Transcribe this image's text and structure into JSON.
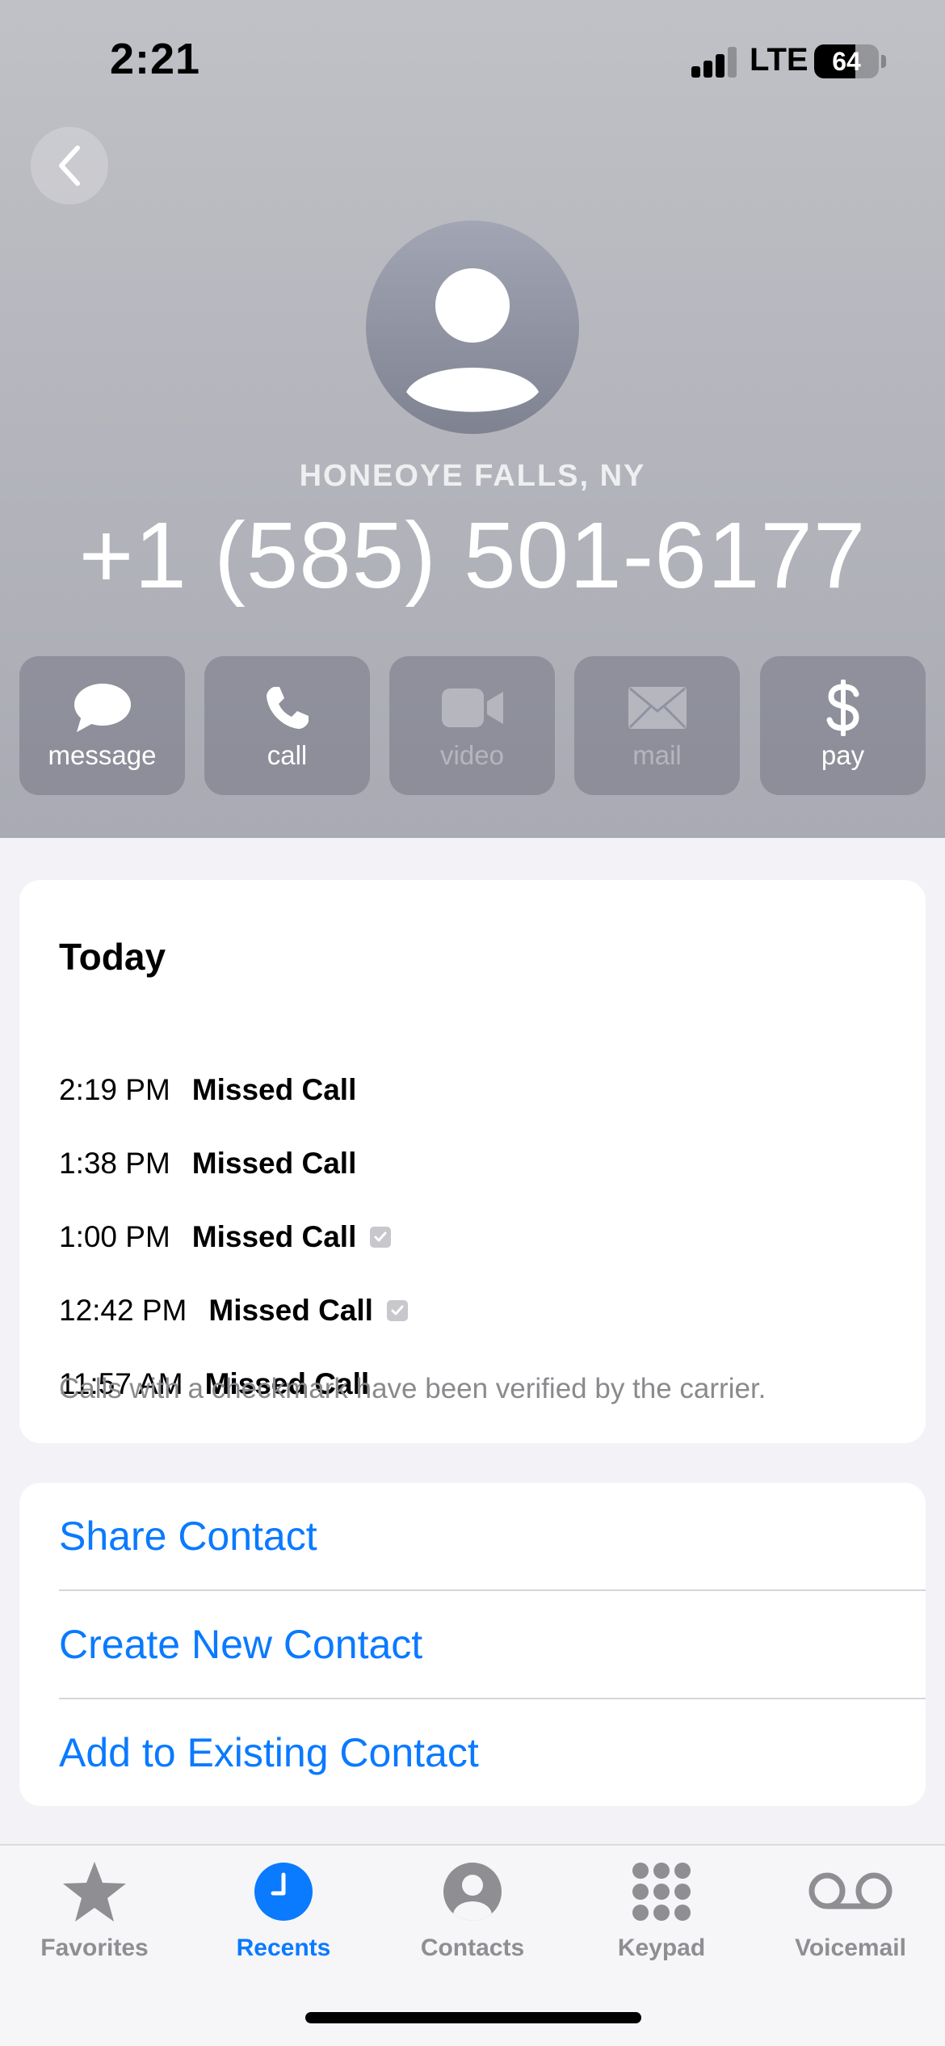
{
  "status_bar": {
    "time": "2:21",
    "network": "LTE",
    "battery_level": "64",
    "battery_fraction": 0.64,
    "signal_bars_active": 3,
    "signal_bars_total": 4
  },
  "contact": {
    "location": "HONEOYE FALLS, NY",
    "phone_number": "+1 (585) 501-6177",
    "avatar_icon": "person-placeholder-icon"
  },
  "actions": [
    {
      "label": "message",
      "icon": "message-bubble-icon",
      "enabled": true
    },
    {
      "label": "call",
      "icon": "phone-icon",
      "enabled": true
    },
    {
      "label": "video",
      "icon": "video-camera-icon",
      "enabled": false
    },
    {
      "label": "mail",
      "icon": "envelope-icon",
      "enabled": false
    },
    {
      "label": "pay",
      "icon": "dollar-icon",
      "enabled": true
    }
  ],
  "history": {
    "heading": "Today",
    "calls": [
      {
        "time": "2:19 PM",
        "type": "Missed Call",
        "verified": false
      },
      {
        "time": "1:38 PM",
        "type": "Missed Call",
        "verified": false
      },
      {
        "time": "1:00 PM",
        "type": "Missed Call",
        "verified": true
      },
      {
        "time": "12:42 PM",
        "type": "Missed Call",
        "verified": true
      },
      {
        "time": "11:57 AM",
        "type": "Missed Call",
        "verified": false
      }
    ],
    "note": "Calls with a checkmark have been verified by the carrier."
  },
  "contact_actions": {
    "share": "Share Contact",
    "create": "Create New Contact",
    "add_existing": "Add to Existing Contact"
  },
  "tab_bar": {
    "tabs": [
      {
        "label": "Favorites",
        "icon": "star-icon",
        "active": false
      },
      {
        "label": "Recents",
        "icon": "clock-icon",
        "active": true
      },
      {
        "label": "Contacts",
        "icon": "person-circle-icon",
        "active": false
      },
      {
        "label": "Keypad",
        "icon": "keypad-icon",
        "active": false
      },
      {
        "label": "Voicemail",
        "icon": "voicemail-icon",
        "active": false
      }
    ]
  },
  "colors": {
    "accent": "#0a7aff",
    "header_top": "#c0c1c6",
    "header_bottom": "#a9aab3",
    "inactive_tab": "#8e8e93",
    "verified_badge": "#c7c7cc"
  }
}
